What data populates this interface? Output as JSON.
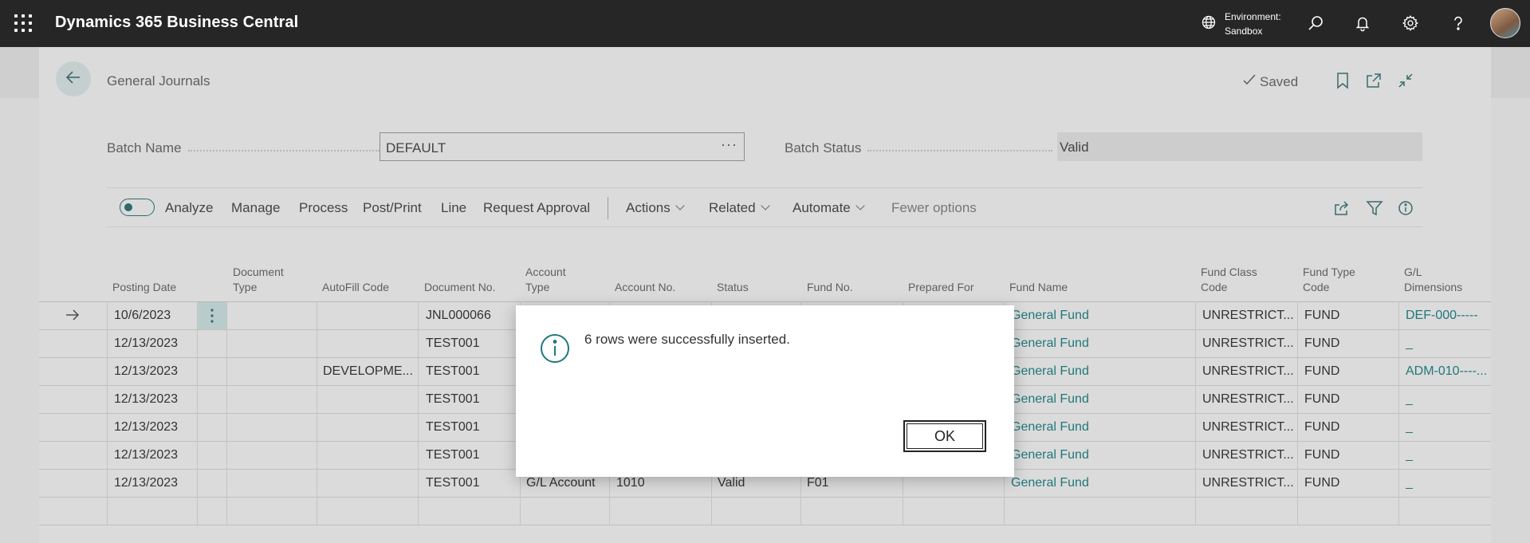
{
  "app": {
    "title": "Dynamics 365 Business Central"
  },
  "topbar": {
    "environment_label": "Environment:",
    "environment_value": "Sandbox"
  },
  "page": {
    "title": "General Journals",
    "saved_label": "Saved"
  },
  "fields": {
    "batch_name_label": "Batch Name",
    "batch_name_value": "DEFAULT",
    "batch_name_ellipsis": "···",
    "batch_status_label": "Batch Status",
    "batch_status_value": "Valid"
  },
  "actionbar": {
    "analyze": "Analyze",
    "manage": "Manage",
    "process": "Process",
    "post_print": "Post/Print",
    "line": "Line",
    "request_approval": "Request Approval",
    "actions": "Actions",
    "related": "Related",
    "automate": "Automate",
    "fewer_options": "Fewer options"
  },
  "grid": {
    "headers": {
      "posting_date": "Posting Date",
      "document_type_1": "Document",
      "document_type_2": "Type",
      "autofill_code": "AutoFill Code",
      "document_no": "Document No.",
      "account_type_1": "Account",
      "account_type_2": "Type",
      "account_no": "Account No.",
      "status": "Status",
      "fund_no": "Fund No.",
      "prepared_for": "Prepared For",
      "fund_name": "Fund Name",
      "fund_class_1": "Fund Class",
      "fund_class_2": "Code",
      "fund_type_1": "Fund Type",
      "fund_type_2": "Code",
      "gl_dim_1": "G/L",
      "gl_dim_2": "Dimensions"
    },
    "rows": [
      {
        "posting_date": "10/6/2023",
        "autofill": "",
        "document_no": "JNL000066",
        "account_type": "",
        "account_no": "",
        "status": "",
        "fund_no": "",
        "fund_name": "General Fund",
        "fund_class": "UNRESTRICT...",
        "fund_type": "FUND",
        "gl_dim": "DEF-000-----"
      },
      {
        "posting_date": "12/13/2023",
        "autofill": "",
        "document_no": "TEST001",
        "account_type": "",
        "account_no": "",
        "status": "",
        "fund_no": "",
        "fund_name": "General Fund",
        "fund_class": "UNRESTRICT...",
        "fund_type": "FUND",
        "gl_dim": "_"
      },
      {
        "posting_date": "12/13/2023",
        "autofill": "DEVELOPME...",
        "document_no": "TEST001",
        "account_type": "",
        "account_no": "",
        "status": "",
        "fund_no": "",
        "fund_name": "General Fund",
        "fund_class": "UNRESTRICT...",
        "fund_type": "FUND",
        "gl_dim": "ADM-010----..."
      },
      {
        "posting_date": "12/13/2023",
        "autofill": "",
        "document_no": "TEST001",
        "account_type": "",
        "account_no": "",
        "status": "",
        "fund_no": "",
        "fund_name": "General Fund",
        "fund_class": "UNRESTRICT...",
        "fund_type": "FUND",
        "gl_dim": "_"
      },
      {
        "posting_date": "12/13/2023",
        "autofill": "",
        "document_no": "TEST001",
        "account_type": "",
        "account_no": "",
        "status": "",
        "fund_no": "",
        "fund_name": "General Fund",
        "fund_class": "UNRESTRICT...",
        "fund_type": "FUND",
        "gl_dim": "_"
      },
      {
        "posting_date": "12/13/2023",
        "autofill": "",
        "document_no": "TEST001",
        "account_type": "",
        "account_no": "",
        "status": "",
        "fund_no": "",
        "fund_name": "General Fund",
        "fund_class": "UNRESTRICT...",
        "fund_type": "FUND",
        "gl_dim": "_"
      },
      {
        "posting_date": "12/13/2023",
        "autofill": "",
        "document_no": "TEST001",
        "account_type": "G/L Account",
        "account_no": "1010",
        "status": "Valid",
        "fund_no": "F01",
        "fund_name": "General Fund",
        "fund_class": "UNRESTRICT...",
        "fund_type": "FUND",
        "gl_dim": "_"
      }
    ]
  },
  "dialog": {
    "message": "6 rows were successfully inserted.",
    "ok_label": "OK"
  },
  "colors": {
    "topbar": "#262626",
    "accent": "#21787a",
    "dialog_bg": "#ffffff"
  },
  "icons": {
    "app_launcher": "waffle-icon",
    "environment": "globe-icon",
    "search": "search-icon",
    "notifications": "bell-icon",
    "settings": "gear-icon",
    "help": "help-icon",
    "back": "back-arrow-icon",
    "saved": "checkmark-icon",
    "bookmark": "bookmark-icon",
    "open_new_window": "open-in-new-icon",
    "collapse": "collapse-icon",
    "share": "share-icon",
    "filter": "filter-icon",
    "info": "info-icon"
  }
}
